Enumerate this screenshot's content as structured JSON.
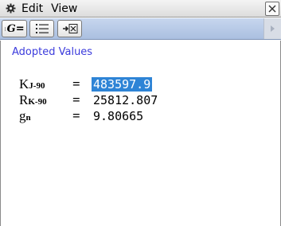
{
  "menubar": {
    "gear_icon": "gear-icon",
    "items": [
      "Edit",
      "View"
    ],
    "close_icon": "close-icon"
  },
  "toolbar": {
    "buttons": [
      {
        "icon": "graph-equation-icon",
        "label": "G="
      },
      {
        "icon": "list-icon"
      },
      {
        "icon": "insert-matrix-icon"
      }
    ],
    "scroll_icon": "scroll-right-icon"
  },
  "content": {
    "title": "Adopted Values",
    "rows": [
      {
        "symbol": "K",
        "subscript": "J-90",
        "equals": "=",
        "value": "483597.9",
        "selected": true
      },
      {
        "symbol": "R",
        "subscript": "K-90",
        "equals": "=",
        "value": "25812.807",
        "selected": false
      },
      {
        "symbol": "g",
        "subscript": "n",
        "equals": "=",
        "value": "9.80665",
        "selected": false
      }
    ]
  },
  "colors": {
    "title": "#3b3bdc",
    "selection": "#2e84d6",
    "toolbar": "#b5c7e6"
  }
}
